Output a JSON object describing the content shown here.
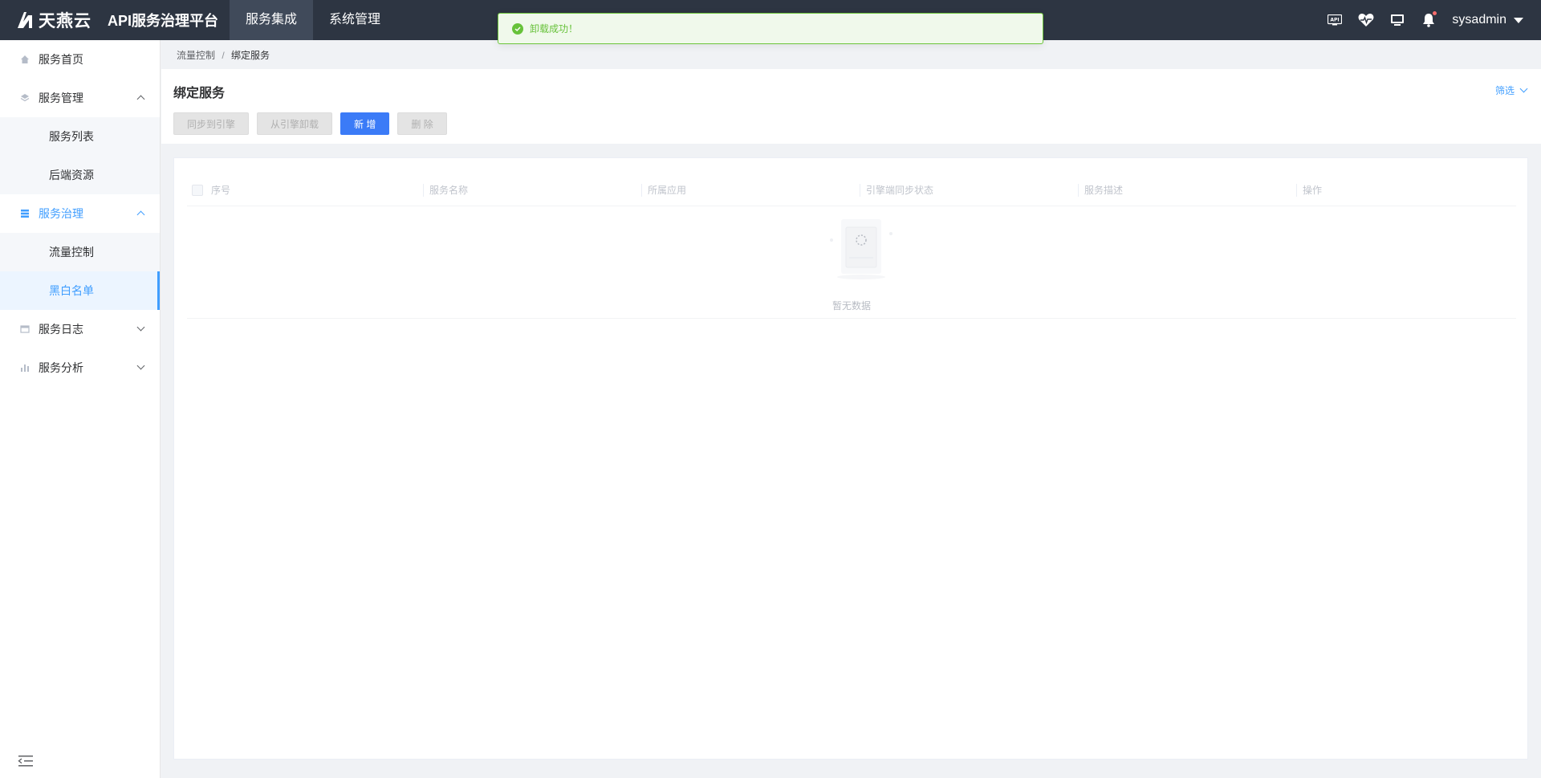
{
  "header": {
    "brand": "天燕云",
    "platform": "API服务治理平台",
    "nav": [
      {
        "label": "服务集成"
      },
      {
        "label": "系统管理"
      }
    ],
    "api_icon_text": "API",
    "username": "sysadmin"
  },
  "toast": {
    "message": "卸载成功！"
  },
  "sidebar": {
    "items": [
      {
        "label": "服务首页"
      },
      {
        "label": "服务管理"
      },
      {
        "label": "服务列表"
      },
      {
        "label": "后端资源"
      },
      {
        "label": "服务治理"
      },
      {
        "label": "流量控制"
      },
      {
        "label": "黑白名单"
      },
      {
        "label": "服务日志"
      },
      {
        "label": "服务分析"
      }
    ]
  },
  "breadcrumb": {
    "parent": "流量控制",
    "separator": "/",
    "current": "绑定服务"
  },
  "page": {
    "title": "绑定服务",
    "filter_label": "筛选",
    "buttons": {
      "sync": "同步到引擎",
      "unload": "从引擎卸载",
      "add": "新 增",
      "delete": "删 除"
    }
  },
  "table": {
    "columns": [
      "序号",
      "服务名称",
      "所属应用",
      "引擎端同步状态",
      "服务描述",
      "操作"
    ],
    "empty_text": "暂无数据"
  },
  "colors": {
    "topbar": "#2d3542",
    "accent": "#409eff",
    "primary_button": "#3b7bf7",
    "success": "#67c23a"
  }
}
